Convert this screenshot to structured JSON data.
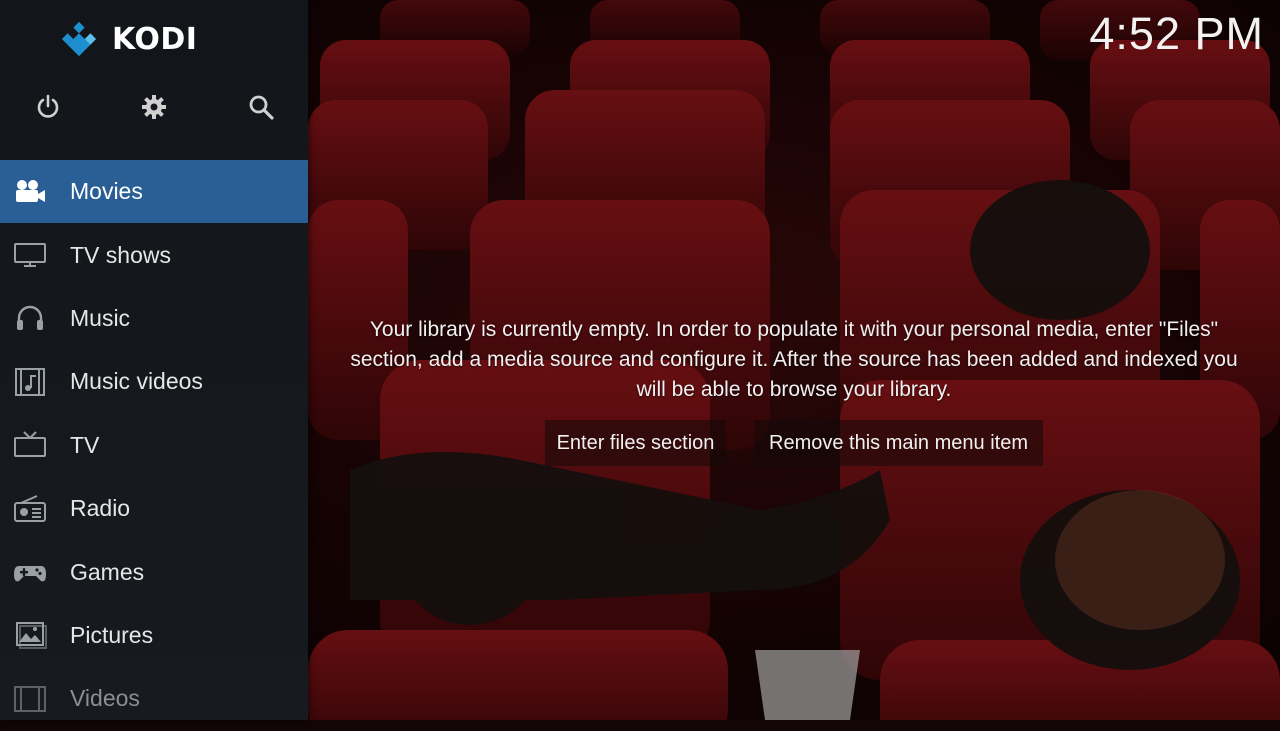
{
  "app": {
    "name": "KODI"
  },
  "clock": {
    "time": "4:52 PM"
  },
  "top_icons": [
    {
      "name": "power-icon"
    },
    {
      "name": "settings-icon"
    },
    {
      "name": "search-icon"
    }
  ],
  "menu": {
    "items": [
      {
        "label": "Movies",
        "icon": "movie-camera-icon",
        "active": true
      },
      {
        "label": "TV shows",
        "icon": "monitor-icon"
      },
      {
        "label": "Music",
        "icon": "headphones-icon"
      },
      {
        "label": "Music videos",
        "icon": "music-video-icon"
      },
      {
        "label": "TV",
        "icon": "tv-icon"
      },
      {
        "label": "Radio",
        "icon": "radio-icon"
      },
      {
        "label": "Games",
        "icon": "gamepad-icon"
      },
      {
        "label": "Pictures",
        "icon": "pictures-icon"
      },
      {
        "label": "Videos",
        "icon": "film-strip-icon"
      }
    ]
  },
  "main": {
    "empty_message": "Your library is currently empty. In order to populate it with your personal media, enter \"Files\" section, add a media source and configure it. After the source has been added and indexed you will be able to browse your library.",
    "enter_files_button": "Enter files section",
    "remove_item_button": "Remove this main menu item"
  },
  "colors": {
    "accent": "#2a5f96",
    "sidebar_bg": "#15181c",
    "logo_blue": "#1d8fcf"
  }
}
